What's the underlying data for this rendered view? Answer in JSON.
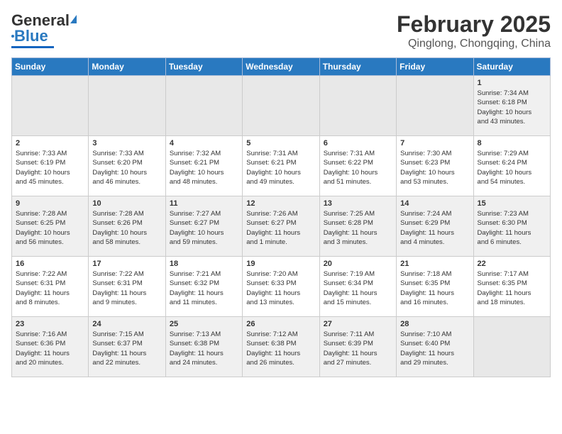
{
  "header": {
    "logo_general": "General",
    "logo_blue": "Blue",
    "month": "February 2025",
    "location": "Qinglong, Chongqing, China"
  },
  "weekdays": [
    "Sunday",
    "Monday",
    "Tuesday",
    "Wednesday",
    "Thursday",
    "Friday",
    "Saturday"
  ],
  "weeks": [
    [
      {
        "day": "",
        "info": ""
      },
      {
        "day": "",
        "info": ""
      },
      {
        "day": "",
        "info": ""
      },
      {
        "day": "",
        "info": ""
      },
      {
        "day": "",
        "info": ""
      },
      {
        "day": "",
        "info": ""
      },
      {
        "day": "1",
        "info": "Sunrise: 7:34 AM\nSunset: 6:18 PM\nDaylight: 10 hours\nand 43 minutes."
      }
    ],
    [
      {
        "day": "2",
        "info": "Sunrise: 7:33 AM\nSunset: 6:19 PM\nDaylight: 10 hours\nand 45 minutes."
      },
      {
        "day": "3",
        "info": "Sunrise: 7:33 AM\nSunset: 6:20 PM\nDaylight: 10 hours\nand 46 minutes."
      },
      {
        "day": "4",
        "info": "Sunrise: 7:32 AM\nSunset: 6:21 PM\nDaylight: 10 hours\nand 48 minutes."
      },
      {
        "day": "5",
        "info": "Sunrise: 7:31 AM\nSunset: 6:21 PM\nDaylight: 10 hours\nand 49 minutes."
      },
      {
        "day": "6",
        "info": "Sunrise: 7:31 AM\nSunset: 6:22 PM\nDaylight: 10 hours\nand 51 minutes."
      },
      {
        "day": "7",
        "info": "Sunrise: 7:30 AM\nSunset: 6:23 PM\nDaylight: 10 hours\nand 53 minutes."
      },
      {
        "day": "8",
        "info": "Sunrise: 7:29 AM\nSunset: 6:24 PM\nDaylight: 10 hours\nand 54 minutes."
      }
    ],
    [
      {
        "day": "9",
        "info": "Sunrise: 7:28 AM\nSunset: 6:25 PM\nDaylight: 10 hours\nand 56 minutes."
      },
      {
        "day": "10",
        "info": "Sunrise: 7:28 AM\nSunset: 6:26 PM\nDaylight: 10 hours\nand 58 minutes."
      },
      {
        "day": "11",
        "info": "Sunrise: 7:27 AM\nSunset: 6:27 PM\nDaylight: 10 hours\nand 59 minutes."
      },
      {
        "day": "12",
        "info": "Sunrise: 7:26 AM\nSunset: 6:27 PM\nDaylight: 11 hours\nand 1 minute."
      },
      {
        "day": "13",
        "info": "Sunrise: 7:25 AM\nSunset: 6:28 PM\nDaylight: 11 hours\nand 3 minutes."
      },
      {
        "day": "14",
        "info": "Sunrise: 7:24 AM\nSunset: 6:29 PM\nDaylight: 11 hours\nand 4 minutes."
      },
      {
        "day": "15",
        "info": "Sunrise: 7:23 AM\nSunset: 6:30 PM\nDaylight: 11 hours\nand 6 minutes."
      }
    ],
    [
      {
        "day": "16",
        "info": "Sunrise: 7:22 AM\nSunset: 6:31 PM\nDaylight: 11 hours\nand 8 minutes."
      },
      {
        "day": "17",
        "info": "Sunrise: 7:22 AM\nSunset: 6:31 PM\nDaylight: 11 hours\nand 9 minutes."
      },
      {
        "day": "18",
        "info": "Sunrise: 7:21 AM\nSunset: 6:32 PM\nDaylight: 11 hours\nand 11 minutes."
      },
      {
        "day": "19",
        "info": "Sunrise: 7:20 AM\nSunset: 6:33 PM\nDaylight: 11 hours\nand 13 minutes."
      },
      {
        "day": "20",
        "info": "Sunrise: 7:19 AM\nSunset: 6:34 PM\nDaylight: 11 hours\nand 15 minutes."
      },
      {
        "day": "21",
        "info": "Sunrise: 7:18 AM\nSunset: 6:35 PM\nDaylight: 11 hours\nand 16 minutes."
      },
      {
        "day": "22",
        "info": "Sunrise: 7:17 AM\nSunset: 6:35 PM\nDaylight: 11 hours\nand 18 minutes."
      }
    ],
    [
      {
        "day": "23",
        "info": "Sunrise: 7:16 AM\nSunset: 6:36 PM\nDaylight: 11 hours\nand 20 minutes."
      },
      {
        "day": "24",
        "info": "Sunrise: 7:15 AM\nSunset: 6:37 PM\nDaylight: 11 hours\nand 22 minutes."
      },
      {
        "day": "25",
        "info": "Sunrise: 7:13 AM\nSunset: 6:38 PM\nDaylight: 11 hours\nand 24 minutes."
      },
      {
        "day": "26",
        "info": "Sunrise: 7:12 AM\nSunset: 6:38 PM\nDaylight: 11 hours\nand 26 minutes."
      },
      {
        "day": "27",
        "info": "Sunrise: 7:11 AM\nSunset: 6:39 PM\nDaylight: 11 hours\nand 27 minutes."
      },
      {
        "day": "28",
        "info": "Sunrise: 7:10 AM\nSunset: 6:40 PM\nDaylight: 11 hours\nand 29 minutes."
      },
      {
        "day": "",
        "info": ""
      }
    ]
  ]
}
